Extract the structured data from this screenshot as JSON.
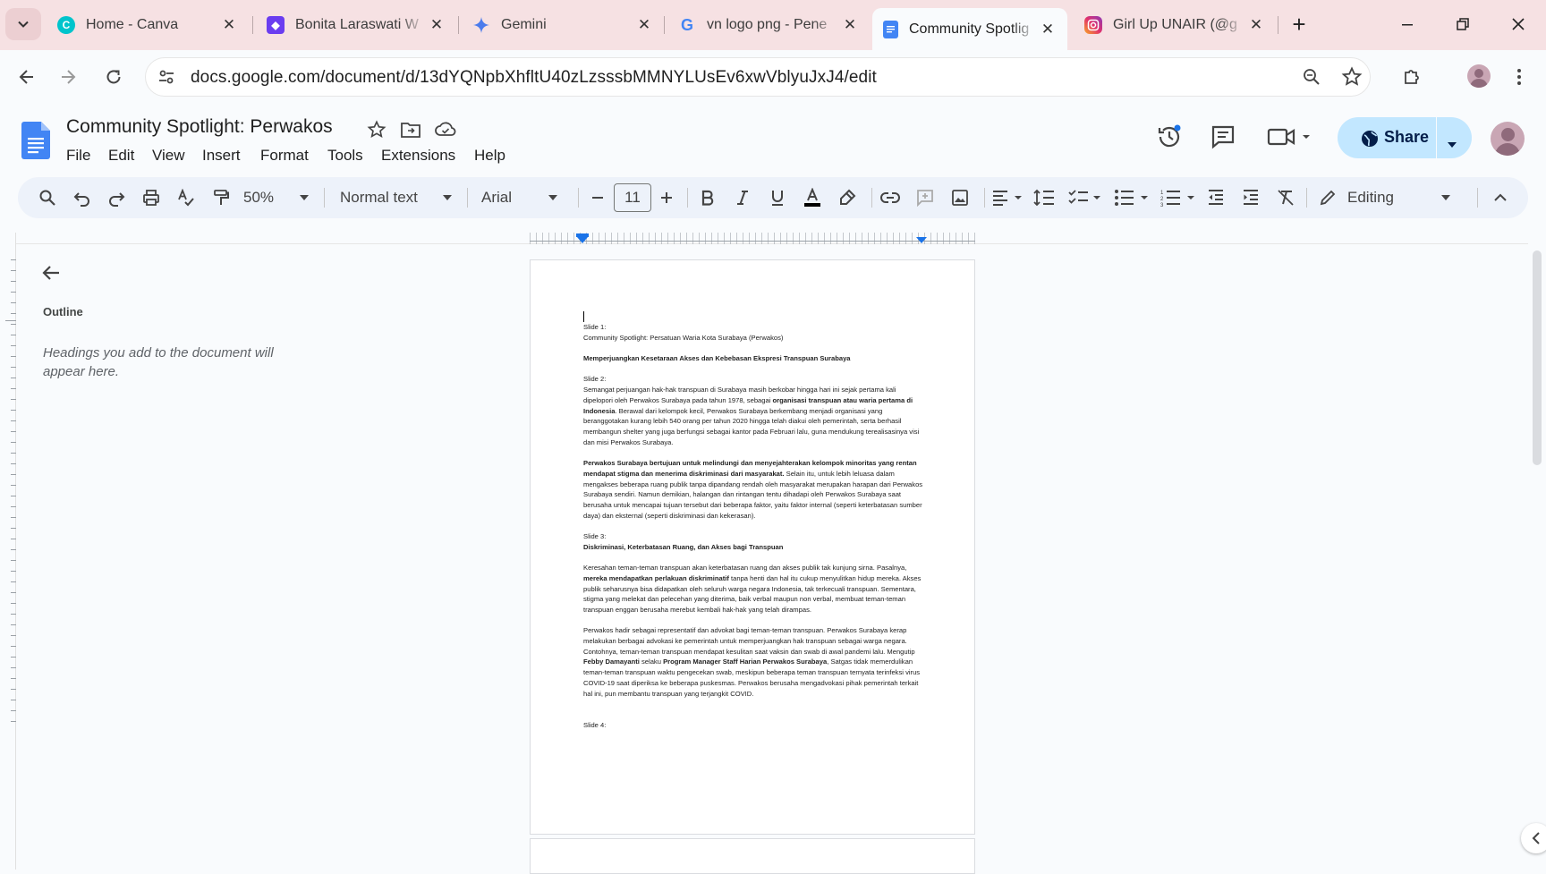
{
  "browser": {
    "tabs": [
      {
        "title": "Home - Canva",
        "icon": "canva-icon",
        "color": "#7d2ae8"
      },
      {
        "title": "Bonita Laraswati W",
        "icon": "portfolio-icon",
        "color": "#6a3df0"
      },
      {
        "title": "Gemini",
        "icon": "gemini-icon",
        "color": "#4285f4"
      },
      {
        "title": "vn logo png - Pene",
        "icon": "google-icon",
        "color": "#ea4335"
      },
      {
        "title": "Community Spotlig",
        "icon": "docs-icon",
        "color": "#4285f4",
        "active": true
      },
      {
        "title": "Girl Up UNAIR (@g",
        "icon": "instagram-icon",
        "color": "#e1306c"
      }
    ],
    "new_tab_symbol": "+",
    "url": "docs.google.com/document/d/13dYQNpbXhfltU40zLzsssbMMNYLUsEv6xwVblyuJxJ4/edit"
  },
  "docs": {
    "title": "Community Spotlight: Perwakos",
    "menus": [
      "File",
      "Edit",
      "View",
      "Insert",
      "Format",
      "Tools",
      "Extensions",
      "Help"
    ],
    "share_label": "Share",
    "toolbar": {
      "zoom": "50%",
      "style": "Normal text",
      "font": "Arial",
      "font_size": "11",
      "mode": "Editing"
    },
    "outline": {
      "heading": "Outline",
      "empty_text": "Headings you add to the document will appear here."
    }
  },
  "document": {
    "paragraphs": [
      [
        {
          "t": "Slide 1:"
        }
      ],
      [
        {
          "t": "Community Spotlight: Persatuan Waria Kota Surabaya (Perwakos)"
        }
      ],
      [],
      [
        {
          "t": "Memperjuangkan Kesetaraan Akses dan Kebebasan Ekspresi Transpuan Surabaya",
          "b": true
        }
      ],
      [],
      [
        {
          "t": "Slide 2:"
        }
      ],
      [
        {
          "t": "Semangat perjuangan hak-hak transpuan di Surabaya masih berkobar hingga hari ini sejak pertama kali dipelopori oleh Perwakos Surabaya pada tahun 1978, sebagai "
        },
        {
          "t": "organisasi transpuan atau waria pertama di Indonesia",
          "b": true
        },
        {
          "t": ". Berawal dari kelompok kecil, Perwakos Surabaya berkembang menjadi organisasi yang beranggotakan kurang lebih 540 orang per tahun 2020 hingga telah diakui oleh pemerintah, serta berhasil membangun shelter yang juga berfungsi sebagai kantor pada Februari lalu, guna mendukung terealisasinya visi dan misi Perwakos Surabaya."
        }
      ],
      [],
      [
        {
          "t": "Perwakos Surabaya bertujuan untuk melindungi dan menyejahterakan kelompok minoritas yang rentan mendapat stigma dan menerima diskriminasi dari masyarakat.",
          "b": true
        },
        {
          "t": " Selain itu, untuk lebih leluasa dalam mengakses beberapa ruang publik tanpa dipandang rendah oleh masyarakat merupakan harapan dari Perwakos Surabaya sendiri. Namun demikian, halangan dan rintangan tentu dihadapi oleh Perwakos Surabaya saat berusaha untuk mencapai tujuan tersebut dari beberapa faktor, yaitu faktor internal (seperti keterbatasan sumber daya) dan eksternal (seperti diskriminasi dan kekerasan)."
        }
      ],
      [],
      [
        {
          "t": "Slide 3:"
        }
      ],
      [
        {
          "t": "Diskriminasi, Keterbatasan Ruang, dan Akses bagi Transpuan",
          "b": true
        }
      ],
      [],
      [
        {
          "t": "Keresahan teman-teman transpuan akan keterbatasan ruang dan akses publik tak kunjung sirna. Pasalnya, "
        },
        {
          "t": "mereka mendapatkan perlakuan diskriminatif",
          "b": true
        },
        {
          "t": " tanpa henti dan hal itu cukup menyulitkan hidup mereka. Akses publik seharusnya bisa didapatkan oleh seluruh warga negara Indonesia, tak terkecuali transpuan. Sementara, stigma yang melekat dan pelecehan yang diterima, baik verbal maupun non verbal, membuat teman-teman transpuan enggan berusaha merebut kembali hak-hak yang telah dirampas."
        }
      ],
      [],
      [
        {
          "t": "Perwakos hadir sebagai representatif dan advokat bagi teman-teman transpuan. Perwakos Surabaya kerap melakukan berbagai advokasi ke pemerintah untuk memperjuangkan hak transpuan sebagai warga negara. Contohnya, teman-teman transpuan mendapat kesulitan saat vaksin dan swab di awal pandemi lalu. Mengutip "
        },
        {
          "t": "Febby Damayanti",
          "b": true
        },
        {
          "t": " selaku "
        },
        {
          "t": "Program Manager Staff Harian Perwakos Surabaya",
          "b": true
        },
        {
          "t": ", Satgas tidak memerdulikan teman-teman transpuan waktu pengecekan swab, meskipun beberapa teman transpuan ternyata terinfeksi virus COVID-19 saat diperiksa ke beberapa puskesmas. Perwakos berusaha mengadvokasi pihak pemerintah terkait hal ini, pun membantu transpuan yang terjangkit COVID."
        }
      ],
      [],
      [],
      [
        {
          "t": "Slide 4:"
        }
      ]
    ]
  }
}
